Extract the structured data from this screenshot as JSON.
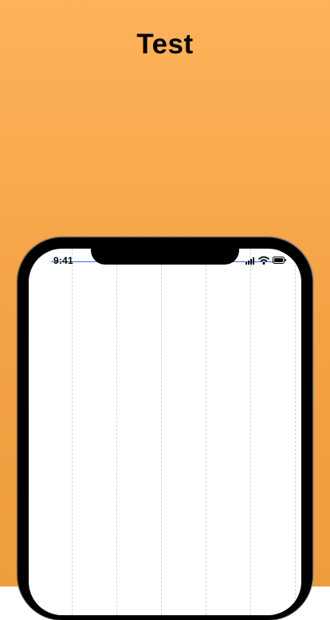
{
  "header": {
    "title": "Test"
  },
  "status_bar": {
    "time": "9:41",
    "icons": [
      "signal-bars-icon",
      "wifi-icon",
      "battery-icon"
    ]
  },
  "colors": {
    "background_top": "#fdb35a",
    "background_bottom": "#ee9d3c",
    "title": "#000000",
    "phone_frame": "#000000",
    "screen": "#ffffff",
    "guide_line": "#2f6fd6"
  }
}
